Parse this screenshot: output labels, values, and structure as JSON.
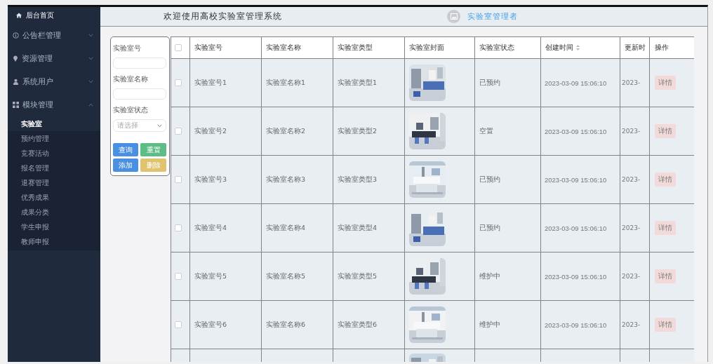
{
  "sidebar": {
    "home": {
      "label": "后台首页"
    },
    "menus": [
      {
        "label": "公告栏管理",
        "expanded": false
      },
      {
        "label": "资源管理",
        "expanded": false
      },
      {
        "label": "系统用户",
        "expanded": false
      },
      {
        "label": "模块管理",
        "expanded": true,
        "children": [
          {
            "label": "实验室",
            "selected": true
          },
          {
            "label": "预约管理",
            "selected": false
          },
          {
            "label": "竞赛活动",
            "selected": false
          },
          {
            "label": "报名管理",
            "selected": false
          },
          {
            "label": "退赛管理",
            "selected": false
          },
          {
            "label": "优秀成果",
            "selected": false
          },
          {
            "label": "成果分类",
            "selected": false
          },
          {
            "label": "学生申报",
            "selected": false
          },
          {
            "label": "教师申报",
            "selected": false
          }
        ]
      }
    ]
  },
  "header": {
    "title": "欢迎使用高校实验室管理系统",
    "user": "实验室管理者"
  },
  "search": {
    "fields": [
      {
        "label": "实验室号",
        "kind": "text"
      },
      {
        "label": "实验室名称",
        "kind": "text"
      },
      {
        "label": "实验室状态",
        "kind": "select",
        "placeholder": "请选择"
      }
    ],
    "buttons": [
      {
        "label": "查询",
        "color": "#4a90e2"
      },
      {
        "label": "重置",
        "color": "#5cbd86"
      },
      {
        "label": "添加",
        "color": "#4a90e2"
      },
      {
        "label": "删除",
        "color": "#e0c36e"
      }
    ]
  },
  "table": {
    "select_all": {
      "checked": false
    },
    "columns": [
      {
        "label": "实验室号",
        "sortable": false
      },
      {
        "label": "实验室名称",
        "sortable": false
      },
      {
        "label": "实验室类型",
        "sortable": false
      },
      {
        "label": "实验室封面",
        "sortable": false
      },
      {
        "label": "实验室状态",
        "sortable": false
      },
      {
        "label": "创建时间",
        "sortable": true
      },
      {
        "label": "更新时",
        "sortable": false
      },
      {
        "label": "操作",
        "sortable": false
      }
    ],
    "rows": [
      {
        "checked": false,
        "number": "实验室号1",
        "name": "实验室名称1",
        "type": "实验室类型1",
        "cover": {
          "kind": "picture"
        },
        "status": "已预约",
        "created": "2023-03-09 15:06:10",
        "updated": "2023-",
        "action": "详情"
      },
      {
        "checked": false,
        "number": "实验室号2",
        "name": "实验室名称2",
        "type": "实验室类型2",
        "cover": {
          "kind": "picture"
        },
        "status": "空置",
        "created": "2023-03-09 15:06:10",
        "updated": "2023-",
        "action": "详情"
      },
      {
        "checked": false,
        "number": "实验室号3",
        "name": "实验室名称3",
        "type": "实验室类型3",
        "cover": {
          "kind": "picture"
        },
        "status": "已预约",
        "created": "2023-03-09 15:06:10",
        "updated": "2023-",
        "action": "详情"
      },
      {
        "checked": false,
        "number": "实验室号4",
        "name": "实验室名称4",
        "type": "实验室类型4",
        "cover": {
          "kind": "picture"
        },
        "status": "已预约",
        "created": "2023-03-09 15:06:10",
        "updated": "2023-",
        "action": "详情"
      },
      {
        "checked": false,
        "number": "实验室号5",
        "name": "实验室名称5",
        "type": "实验室类型5",
        "cover": {
          "kind": "picture"
        },
        "status": "维护中",
        "created": "2023-03-09 15:06:10",
        "updated": "2023-",
        "action": "详情"
      },
      {
        "checked": false,
        "number": "实验室号6",
        "name": "实验室名称6",
        "type": "实验室类型6",
        "cover": {
          "kind": "picture"
        },
        "status": "维护中",
        "created": "2023-03-09 15:06:10",
        "updated": "2023-",
        "action": "详情"
      },
      {
        "cover": {
          "kind": "picture"
        }
      }
    ]
  }
}
